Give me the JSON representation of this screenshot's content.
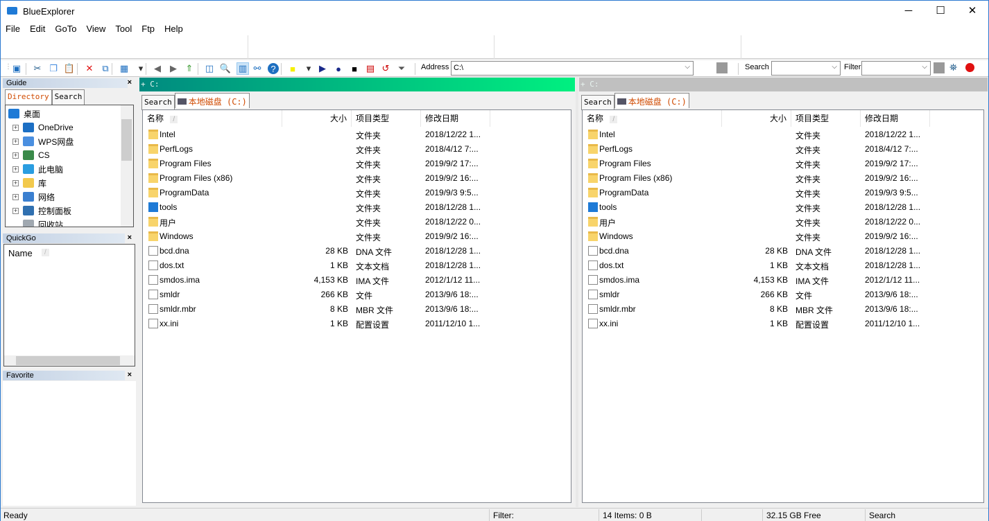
{
  "window": {
    "title": "BlueExplorer",
    "minimize": "─",
    "maximize": "☐",
    "close": "✕"
  },
  "menu": [
    "File",
    "Edit",
    "GoTo",
    "View",
    "Tool",
    "Ftp",
    "Help"
  ],
  "toolbar": {
    "address_label": "Address",
    "address_value": "C:\\",
    "search_label": "Search",
    "search_value": "",
    "filter_label": "Filter",
    "filter_value": "",
    "icons": [
      "save-icon",
      "cut-icon",
      "copy-icon",
      "paste-icon",
      "delete-icon",
      "move-icon",
      "view-grid-icon",
      "dropdown-icon",
      "back-icon",
      "forward-icon",
      "up-folder-icon",
      "split-view-icon",
      "find-icon",
      "panel-icon",
      "network-icon",
      "help-icon",
      "yellow-square-icon",
      "dropdown-icon",
      "play-icon",
      "record-icon",
      "stop-icon",
      "new-list-icon",
      "undo-list-icon",
      "filter-icon"
    ]
  },
  "guide": {
    "title": "Guide",
    "close": "×",
    "tabs": [
      "Directory",
      "Search"
    ],
    "tree": [
      {
        "label": "桌面",
        "color": "#1e7ad6"
      },
      {
        "label": "OneDrive",
        "color": "#1c6fc4"
      },
      {
        "label": "WPS网盘",
        "color": "#4a8fe0"
      },
      {
        "label": "CS",
        "color": "#3a8a4a"
      },
      {
        "label": "此电脑",
        "color": "#2a9de0"
      },
      {
        "label": "库",
        "color": "#f2c94c"
      },
      {
        "label": "网络",
        "color": "#3a7fd0"
      },
      {
        "label": "控制面板",
        "color": "#3070b0"
      },
      {
        "label": "回收站",
        "color": "#a0a8b0"
      }
    ]
  },
  "quickgo": {
    "title": "QuickGo",
    "close": "×",
    "column": "Name",
    "sort": "/"
  },
  "favorite": {
    "title": "Favorite",
    "close": "×"
  },
  "panes": [
    {
      "path": "+ C:",
      "active": true,
      "tabs": [
        "Search",
        "本地磁盘 (C:)"
      ]
    },
    {
      "path": "+ C:",
      "active": false,
      "tabs": [
        "Search",
        "本地磁盘 (C:)"
      ]
    }
  ],
  "columns": {
    "name": "名称",
    "sort": "/",
    "size": "大小",
    "type": "项目类型",
    "date": "修改日期"
  },
  "files": [
    {
      "name": "Intel",
      "size": "",
      "type": "文件夹",
      "date": "2018/12/22 1...",
      "kind": "folder"
    },
    {
      "name": "PerfLogs",
      "size": "",
      "type": "文件夹",
      "date": "2018/4/12 7:...",
      "kind": "folder"
    },
    {
      "name": "Program Files",
      "size": "",
      "type": "文件夹",
      "date": "2019/9/2 17:...",
      "kind": "folder"
    },
    {
      "name": "Program Files (x86)",
      "size": "",
      "type": "文件夹",
      "date": "2019/9/2 16:...",
      "kind": "folder"
    },
    {
      "name": "ProgramData",
      "size": "",
      "type": "文件夹",
      "date": "2019/9/3 9:5...",
      "kind": "folder"
    },
    {
      "name": "tools",
      "size": "",
      "type": "文件夹",
      "date": "2018/12/28 1...",
      "kind": "tool"
    },
    {
      "name": "用户",
      "size": "",
      "type": "文件夹",
      "date": "2018/12/22 0...",
      "kind": "folder"
    },
    {
      "name": "Windows",
      "size": "",
      "type": "文件夹",
      "date": "2019/9/2 16:...",
      "kind": "folder"
    },
    {
      "name": "bcd.dna",
      "size": "28 KB",
      "type": "DNA 文件",
      "date": "2018/12/28 1...",
      "kind": "file"
    },
    {
      "name": "dos.txt",
      "size": "1 KB",
      "type": "文本文档",
      "date": "2018/12/28 1...",
      "kind": "file"
    },
    {
      "name": "smdos.ima",
      "size": "4,153 KB",
      "type": "IMA 文件",
      "date": "2012/1/12 11...",
      "kind": "file"
    },
    {
      "name": "smldr",
      "size": "266 KB",
      "type": "文件",
      "date": "2013/9/6 18:...",
      "kind": "file"
    },
    {
      "name": "smldr.mbr",
      "size": "8 KB",
      "type": "MBR 文件",
      "date": "2013/9/6 18:...",
      "kind": "file"
    },
    {
      "name": "xx.ini",
      "size": "1 KB",
      "type": "配置设置",
      "date": "2011/12/10 1...",
      "kind": "file"
    }
  ],
  "status": {
    "ready": "Ready",
    "filter": "Filter:",
    "items": "14 Items:  0  B",
    "free": "32.15 GB Free",
    "search": "Search"
  },
  "colors": {
    "active_header": "#00f080",
    "inactive_header": "#c0c0c0",
    "tab_text": "#d04a00"
  }
}
